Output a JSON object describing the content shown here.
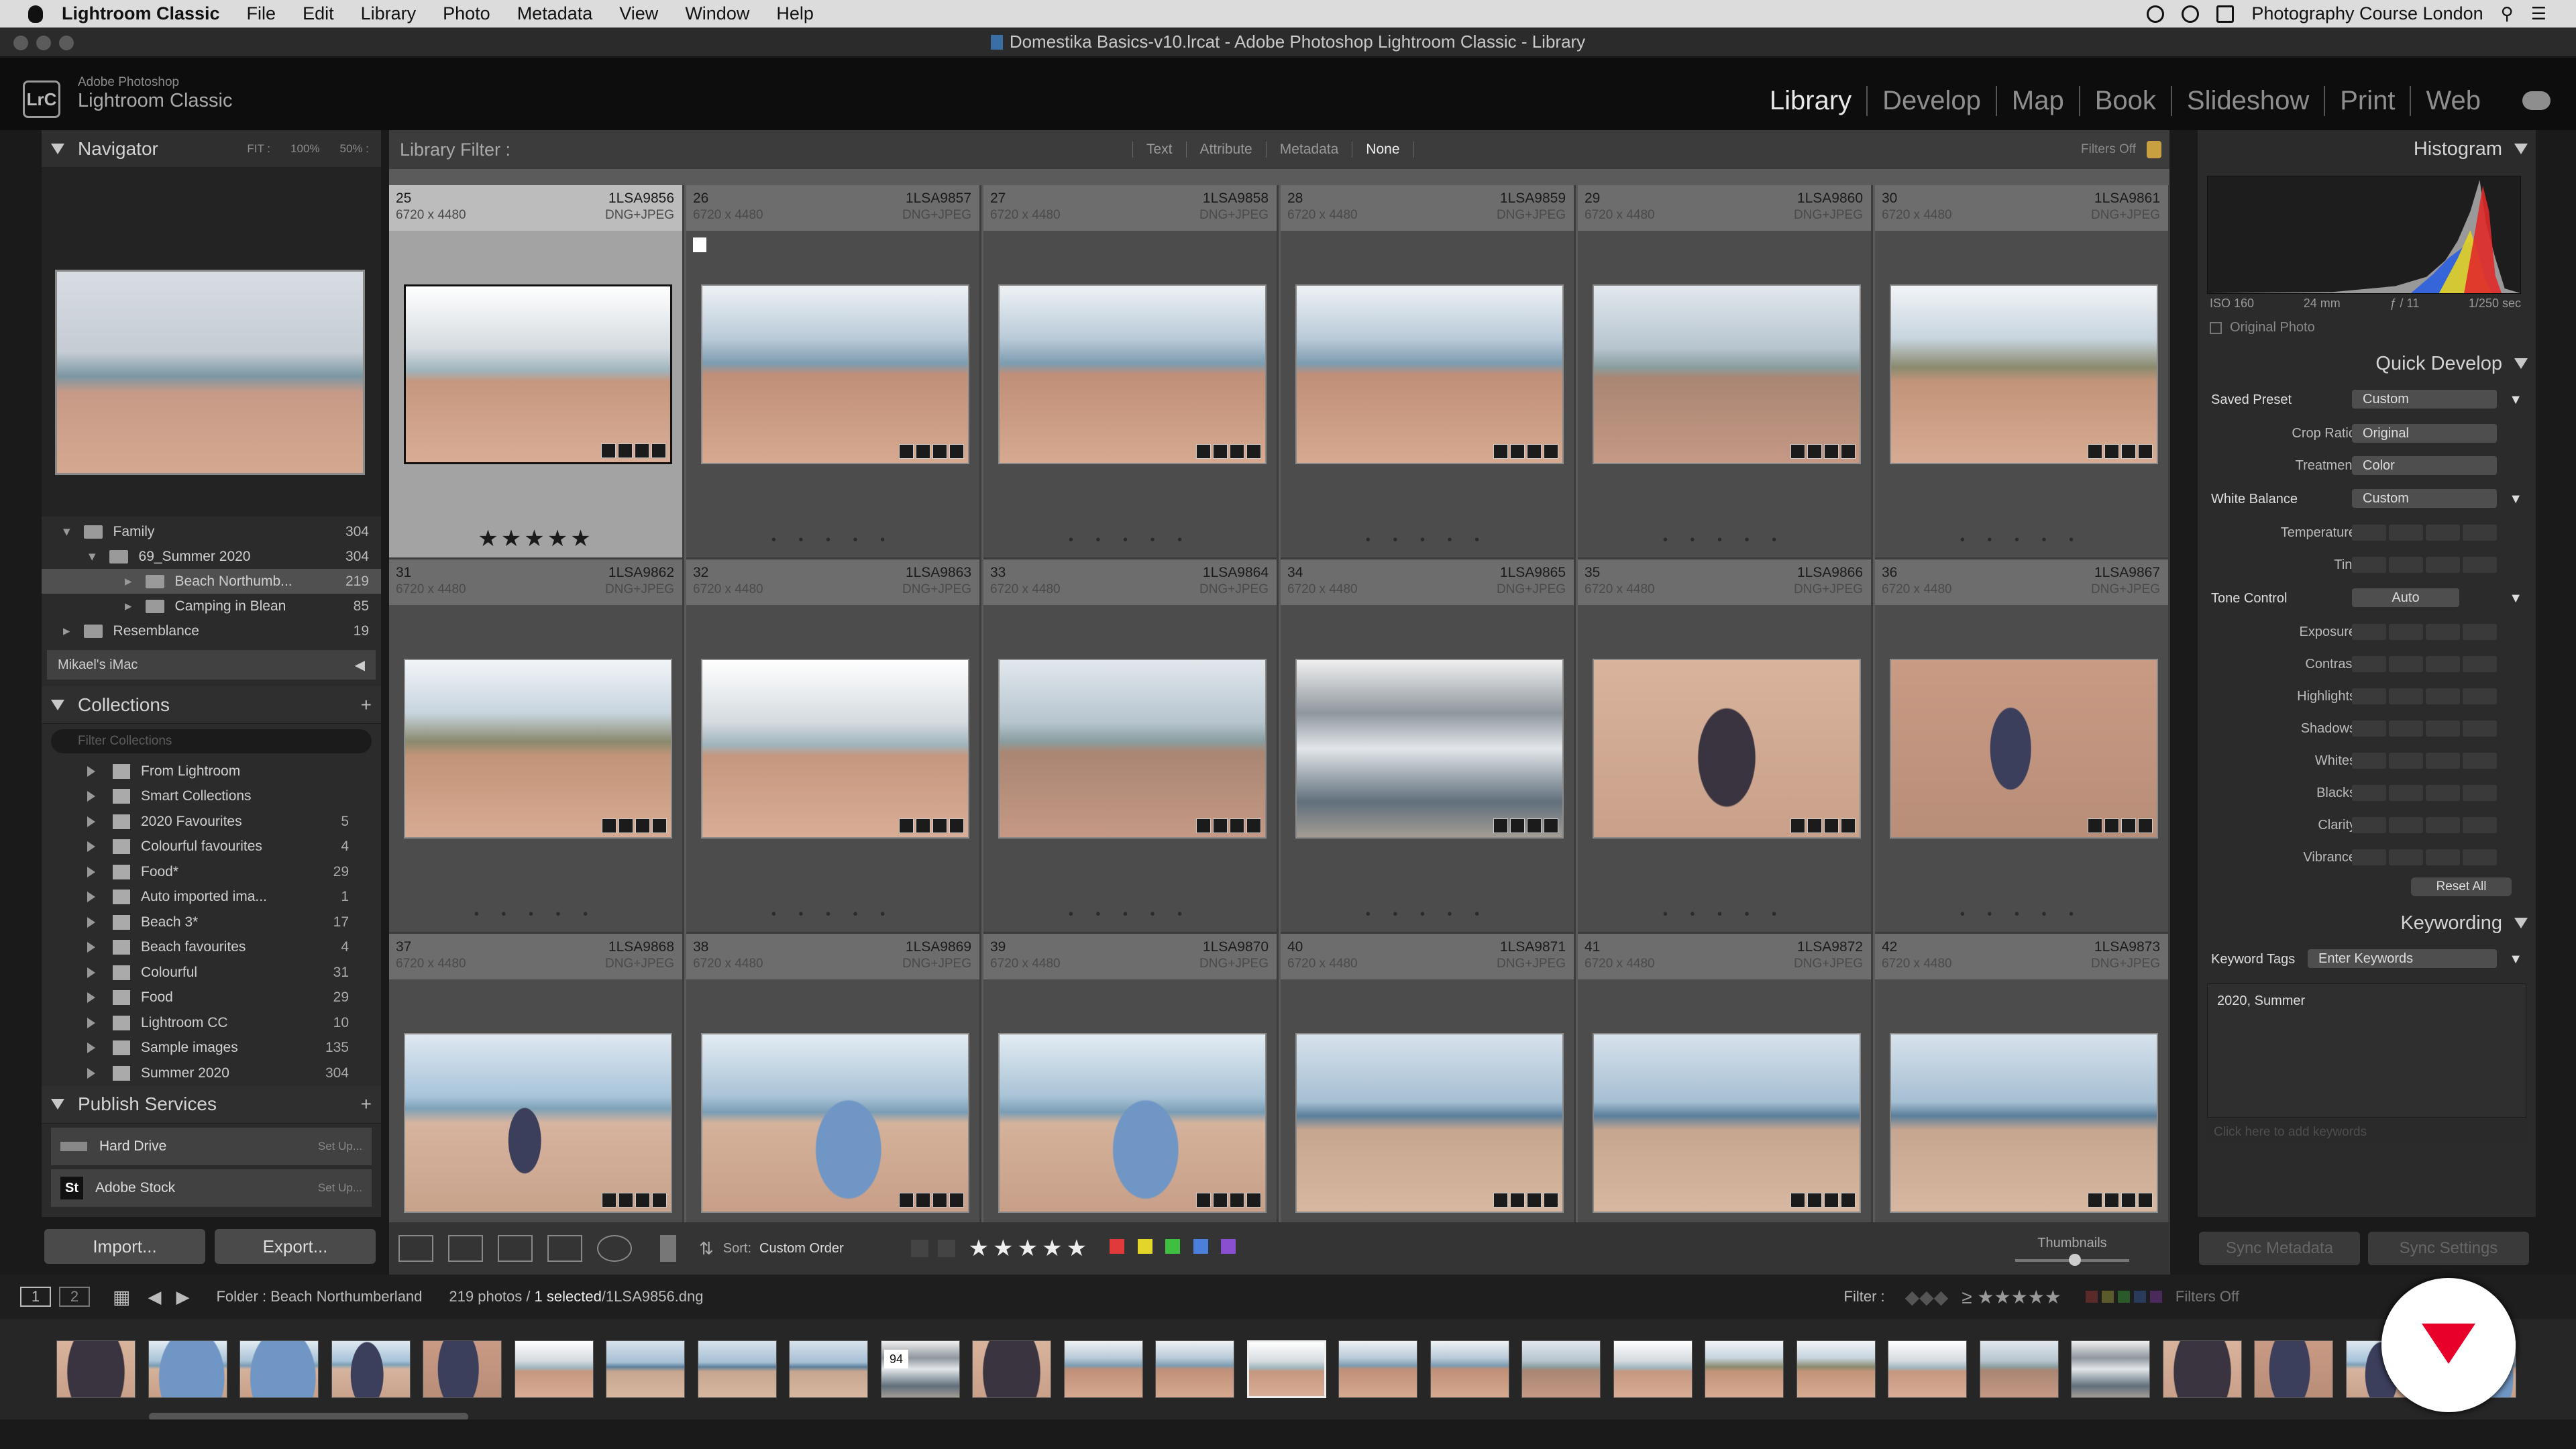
{
  "menubar": {
    "app": "Lightroom Classic",
    "items": [
      "File",
      "Edit",
      "Library",
      "Photo",
      "Metadata",
      "View",
      "Window",
      "Help"
    ],
    "right_text": "Photography Course London"
  },
  "window_title": "Domestika Basics-v10.lrcat - Adobe Photoshop Lightroom Classic - Library",
  "brand": {
    "logo": "LrC",
    "small": "Adobe Photoshop",
    "big": "Lightroom Classic"
  },
  "modules": [
    "Library",
    "Develop",
    "Map",
    "Book",
    "Slideshow",
    "Print",
    "Web"
  ],
  "left": {
    "navigator": {
      "title": "Navigator",
      "zoom": [
        "FIT :",
        "100%",
        "50% :"
      ]
    },
    "folders": [
      {
        "label": "Family",
        "count": "304"
      },
      {
        "label": "69_Summer 2020",
        "count": "304"
      },
      {
        "label": "Beach Northumb...",
        "count": "219"
      },
      {
        "label": "Camping in Blean",
        "count": "85"
      },
      {
        "label": "Resemblance",
        "count": "19"
      }
    ],
    "volume": "Mikael's iMac",
    "collections_title": "Collections",
    "collections_search": "Filter Collections",
    "collections": [
      {
        "label": "From Lightroom",
        "count": ""
      },
      {
        "label": "Smart Collections",
        "count": ""
      },
      {
        "label": "2020 Favourites",
        "count": "5"
      },
      {
        "label": "Colourful favourites",
        "count": "4"
      },
      {
        "label": "Food*",
        "count": "29"
      },
      {
        "label": "Auto imported ima...",
        "count": "1"
      },
      {
        "label": "Beach 3*",
        "count": "17"
      },
      {
        "label": "Beach favourites",
        "count": "4"
      },
      {
        "label": "Colourful",
        "count": "31"
      },
      {
        "label": "Food",
        "count": "29"
      },
      {
        "label": "Lightroom CC",
        "count": "10"
      },
      {
        "label": "Sample images",
        "count": "135"
      },
      {
        "label": "Summer 2020",
        "count": "304"
      }
    ],
    "publish_title": "Publish Services",
    "publish": [
      {
        "label": "Hard Drive",
        "action": "Set Up..."
      },
      {
        "label": "Adobe Stock",
        "action": "Set Up..."
      }
    ],
    "import_label": "Import...",
    "export_label": "Export..."
  },
  "filter": {
    "title": "Library Filter :",
    "tabs": [
      "Text",
      "Attribute",
      "Metadata",
      "None"
    ],
    "status": "Filters Off"
  },
  "grid": [
    {
      "num": "25",
      "file": "1LSA9856",
      "dims": "6720 x 4480",
      "type": "DNG+JPEG",
      "style": "beach1",
      "selected": true,
      "stars": "★★★★★"
    },
    {
      "num": "26",
      "file": "1LSA9857",
      "dims": "6720 x 4480",
      "type": "DNG+JPEG",
      "style": "beach2",
      "flag": true
    },
    {
      "num": "27",
      "file": "1LSA9858",
      "dims": "6720 x 4480",
      "type": "DNG+JPEG",
      "style": "beach2"
    },
    {
      "num": "28",
      "file": "1LSA9859",
      "dims": "6720 x 4480",
      "type": "DNG+JPEG",
      "style": "beach2"
    },
    {
      "num": "29",
      "file": "1LSA9860",
      "dims": "6720 x 4480",
      "type": "DNG+JPEG",
      "style": "beach3"
    },
    {
      "num": "30",
      "file": "1LSA9861",
      "dims": "6720 x 4480",
      "type": "DNG+JPEG",
      "style": "dune"
    },
    {
      "num": "31",
      "file": "1LSA9862",
      "dims": "6720 x 4480",
      "type": "DNG+JPEG",
      "style": "dune"
    },
    {
      "num": "32",
      "file": "1LSA9863",
      "dims": "6720 x 4480",
      "type": "DNG+JPEG",
      "style": "beach1"
    },
    {
      "num": "33",
      "file": "1LSA9864",
      "dims": "6720 x 4480",
      "type": "DNG+JPEG",
      "style": "beach3"
    },
    {
      "num": "34",
      "file": "1LSA9865",
      "dims": "6720 x 4480",
      "type": "DNG+JPEG",
      "style": "storm"
    },
    {
      "num": "35",
      "file": "1LSA9866",
      "dims": "6720 x 4480",
      "type": "DNG+JPEG",
      "style": "child"
    },
    {
      "num": "36",
      "file": "1LSA9867",
      "dims": "6720 x 4480",
      "type": "DNG+JPEG",
      "style": "child2"
    },
    {
      "num": "37",
      "file": "1LSA9868",
      "dims": "6720 x 4480",
      "type": "DNG+JPEG",
      "style": "kid-sea"
    },
    {
      "num": "38",
      "file": "1LSA9869",
      "dims": "6720 x 4480",
      "type": "DNG+JPEG",
      "style": "toddler"
    },
    {
      "num": "39",
      "file": "1LSA9870",
      "dims": "6720 x 4480",
      "type": "DNG+JPEG",
      "style": "toddler"
    },
    {
      "num": "40",
      "file": "1LSA9871",
      "dims": "6720 x 4480",
      "type": "DNG+JPEG",
      "style": "sea"
    },
    {
      "num": "41",
      "file": "1LSA9872",
      "dims": "6720 x 4480",
      "type": "DNG+JPEG",
      "style": "sea"
    },
    {
      "num": "42",
      "file": "1LSA9873",
      "dims": "6720 x 4480",
      "type": "DNG+JPEG",
      "style": "sea"
    }
  ],
  "toolbar": {
    "sort_label": "Sort:",
    "sort_value": "Custom Order",
    "stars": "★★★★★",
    "thumbnails_label": "Thumbnails",
    "colors": [
      "#e03a3a",
      "#e3d52a",
      "#3fbf3f",
      "#4a7fdc",
      "#8a4fd0"
    ]
  },
  "right": {
    "histogram_title": "Histogram",
    "hist_info": [
      "ISO 160",
      "24 mm",
      "ƒ / 11",
      "1/250 sec"
    ],
    "original_photo": "Original Photo",
    "qd_title": "Quick Develop",
    "saved_preset_label": "Saved Preset",
    "saved_preset_value": "Custom",
    "crop_label": "Crop Ratio",
    "crop_value": "Original",
    "treatment_label": "Treatment",
    "treatment_value": "Color",
    "wb_label": "White Balance",
    "wb_value": "Custom",
    "wb_rows": [
      "Temperature",
      "Tint"
    ],
    "tone_label": "Tone Control",
    "tone_value": "Auto",
    "tone_rows": [
      "Exposure",
      "Contrast",
      "Highlights",
      "Shadows",
      "Whites",
      "Blacks",
      "Clarity",
      "Vibrance"
    ],
    "reset": "Reset All",
    "keywording_title": "Keywording",
    "kw_tags_label": "Keyword Tags",
    "kw_tags_value": "Enter Keywords",
    "kw_text": "2020, Summer",
    "kw_hint": "Click here to add keywords",
    "sync_metadata": "Sync Metadata",
    "sync_settings": "Sync Settings"
  },
  "statusbar": {
    "pages": [
      "1",
      "2"
    ],
    "folder": "Folder : Beach Northumberland",
    "count": "219 photos /",
    "selected": "1 selected",
    "file": "/1LSA9856.dng",
    "filter_label": "Filter :",
    "filter_btn": "Filters Off"
  },
  "filmstrip": {
    "badge": "94"
  }
}
